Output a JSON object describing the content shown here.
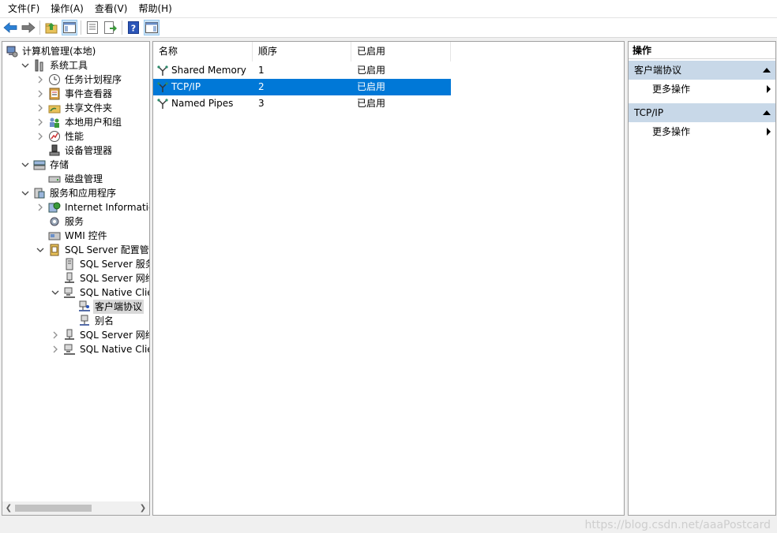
{
  "menu": [
    "文件(F)",
    "操作(A)",
    "查看(V)",
    "帮助(H)"
  ],
  "toolbar": {
    "buttons": [
      "back-icon",
      "forward-icon",
      "up-folder-icon",
      "show-hide-tree-icon",
      "properties-icon",
      "export-list-icon",
      "help-icon",
      "show-hide-action-pane-icon"
    ]
  },
  "tree": {
    "items": [
      {
        "label": "计算机管理(本地)",
        "icon": "computer-management-icon",
        "arrow": "none",
        "level": 0
      },
      {
        "label": "系统工具",
        "icon": "system-tools-icon",
        "arrow": "down",
        "level": 1
      },
      {
        "label": "任务计划程序",
        "icon": "clock-icon",
        "arrow": "right",
        "level": 2
      },
      {
        "label": "事件查看器",
        "icon": "event-viewer-icon",
        "arrow": "right",
        "level": 2
      },
      {
        "label": "共享文件夹",
        "icon": "shared-folder-icon",
        "arrow": "right",
        "level": 2
      },
      {
        "label": "本地用户和组",
        "icon": "users-icon",
        "arrow": "right",
        "level": 2
      },
      {
        "label": "性能",
        "icon": "performance-icon",
        "arrow": "right",
        "level": 2
      },
      {
        "label": "设备管理器",
        "icon": "device-manager-icon",
        "arrow": "none",
        "level": 2
      },
      {
        "label": "存储",
        "icon": "storage-icon",
        "arrow": "down",
        "level": 1
      },
      {
        "label": "磁盘管理",
        "icon": "disk-icon",
        "arrow": "none",
        "level": 2
      },
      {
        "label": "服务和应用程序",
        "icon": "services-apps-icon",
        "arrow": "down",
        "level": 1
      },
      {
        "label": "Internet Information Services",
        "icon": "iis-icon",
        "arrow": "right",
        "level": 2
      },
      {
        "label": "服务",
        "icon": "gear-icon",
        "arrow": "none",
        "level": 2
      },
      {
        "label": "WMI 控件",
        "icon": "wmi-icon",
        "arrow": "none",
        "level": 2
      },
      {
        "label": "SQL Server 配置管理器",
        "icon": "sql-config-icon",
        "arrow": "down",
        "level": 2
      },
      {
        "label": "SQL Server 服务",
        "icon": "server-icon",
        "arrow": "none",
        "level": 3
      },
      {
        "label": "SQL Server 网络配置",
        "icon": "network-config-icon",
        "arrow": "none",
        "level": 3
      },
      {
        "label": "SQL Native Client",
        "icon": "native-client-icon",
        "arrow": "down",
        "level": 3
      },
      {
        "label": "客户端协议",
        "icon": "client-protocol-icon",
        "arrow": "none",
        "level": 4,
        "selected": true
      },
      {
        "label": "别名",
        "icon": "alias-icon",
        "arrow": "none",
        "level": 4
      },
      {
        "label": "SQL Server 网络配置",
        "icon": "network-config-icon",
        "arrow": "right",
        "level": 3
      },
      {
        "label": "SQL Native Client",
        "icon": "native-client-icon",
        "arrow": "right",
        "level": 3
      }
    ]
  },
  "list": {
    "columns": [
      "名称",
      "顺序",
      "已启用"
    ],
    "rows": [
      {
        "name": "Shared Memory",
        "order": "1",
        "enabled": "已启用"
      },
      {
        "name": "TCP/IP",
        "order": "2",
        "enabled": "已启用",
        "selected": true
      },
      {
        "name": "Named Pipes",
        "order": "3",
        "enabled": "已启用"
      }
    ]
  },
  "actions": {
    "title": "操作",
    "sections": [
      {
        "label": "客户端协议",
        "items": [
          "更多操作"
        ]
      },
      {
        "label": "TCP/IP",
        "items": [
          "更多操作"
        ]
      }
    ]
  },
  "watermark": "https://blog.csdn.net/aaaPostcard",
  "colors": {
    "selection": "#0078d7",
    "section_header": "#c8d8e8",
    "tree_selected": "#d9d9d9"
  }
}
